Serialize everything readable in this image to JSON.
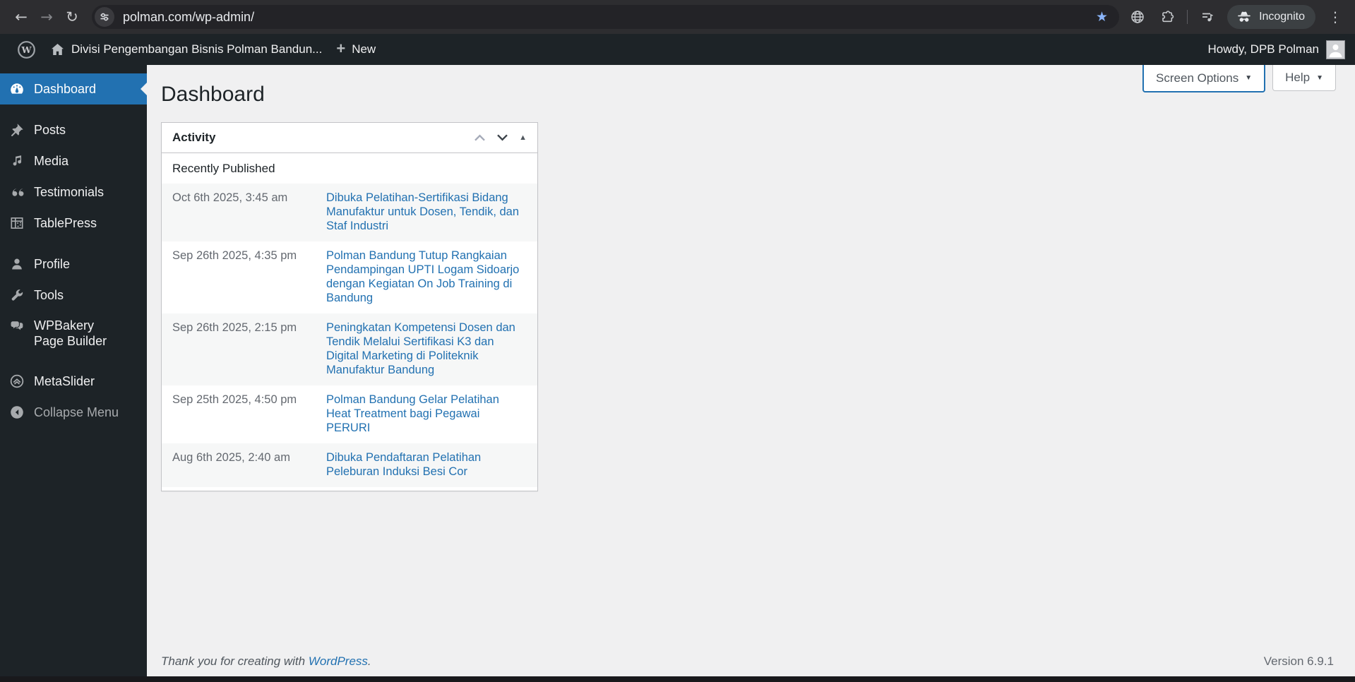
{
  "browser": {
    "url": "polman.com/wp-admin/",
    "incognito_label": "Incognito",
    "icons": [
      "back-icon",
      "forward-icon",
      "reload-icon",
      "site-settings-icon",
      "bookmark-star-icon",
      "globe-icon",
      "extensions-icon",
      "media-controls-icon",
      "incognito-icon",
      "menu-dots-icon"
    ]
  },
  "admin_bar": {
    "site_name": "Divisi Pengembangan Bisnis Polman Bandun...",
    "new_label": "New",
    "howdy": "Howdy, DPB Polman",
    "icons": [
      "wordpress-logo-icon",
      "home-icon",
      "plus-icon",
      "avatar"
    ]
  },
  "sidebar": {
    "items": [
      {
        "label": "Dashboard",
        "icon": "dashboard-gauge-icon",
        "active": true
      },
      {
        "label": "Posts",
        "icon": "pushpin-icon"
      },
      {
        "label": "Media",
        "icon": "media-notes-icon"
      },
      {
        "label": "Testimonials",
        "icon": "quote-icon"
      },
      {
        "label": "TablePress",
        "icon": "table-icon"
      },
      {
        "label": "Profile",
        "icon": "user-icon"
      },
      {
        "label": "Tools",
        "icon": "wrench-icon"
      },
      {
        "label": "WPBakery Page Builder",
        "icon": "chat-bubbles-icon"
      },
      {
        "label": "MetaSlider",
        "icon": "metaslider-icon"
      },
      {
        "label": "Collapse Menu",
        "icon": "collapse-arrow-icon"
      }
    ]
  },
  "main": {
    "page_title": "Dashboard",
    "screen_options_label": "Screen Options",
    "help_label": "Help",
    "activity": {
      "title": "Activity",
      "section_title": "Recently Published",
      "entries": [
        {
          "date": "Oct 6th 2025, 3:45 am",
          "title": "Dibuka Pelatihan-Sertifikasi Bidang Manufaktur untuk Dosen, Tendik, dan Staf Industri"
        },
        {
          "date": "Sep 26th 2025, 4:35 pm",
          "title": "Polman Bandung Tutup Rangkaian Pendampingan UPTI Logam Sidoarjo dengan Kegiatan On Job Training di Bandung"
        },
        {
          "date": "Sep 26th 2025, 2:15 pm",
          "title": "Peningkatan Kompetensi Dosen dan Tendik Melalui Sertifikasi K3 dan Digital Marketing di Politeknik Manufaktur Bandung"
        },
        {
          "date": "Sep 25th 2025, 4:50 pm",
          "title": "Polman Bandung Gelar Pelatihan Heat Treatment bagi Pegawai PERURI"
        },
        {
          "date": "Aug 6th 2025, 2:40 am",
          "title": "Dibuka Pendaftaran Pelatihan Peleburan Induksi Besi Cor"
        }
      ]
    },
    "footer": {
      "thanks_prefix": "Thank you for creating with ",
      "wordpress_link": "WordPress",
      "thanks_suffix": ".",
      "version": "Version 6.9.1"
    }
  },
  "colors": {
    "accent_blue": "#2271b1",
    "admin_dark": "#1d2327",
    "content_bg": "#f0f0f1",
    "toolbar_dark": "#2d2d30",
    "link_blue": "#2271b1",
    "muted_gray": "#646970",
    "bookmark_star": "#8ab4f8"
  }
}
